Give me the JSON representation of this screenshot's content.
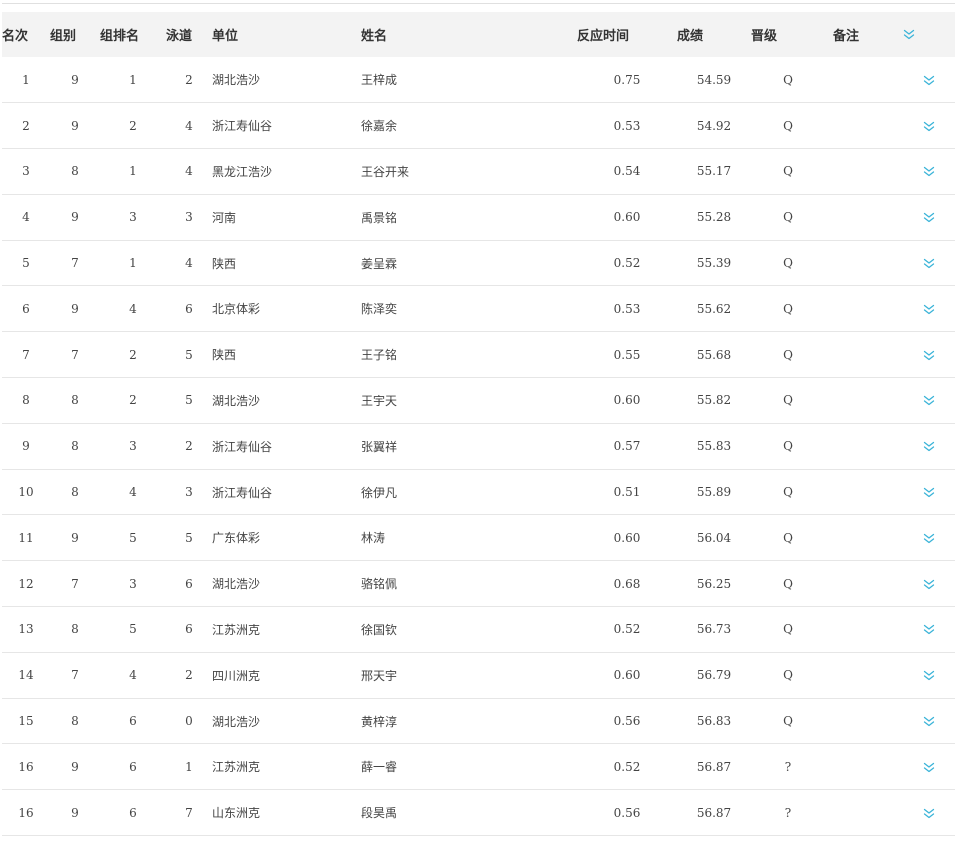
{
  "table": {
    "headers": {
      "rank": "名次",
      "group": "组别",
      "group_rank": "组排名",
      "lane": "泳道",
      "unit": "单位",
      "name": "姓名",
      "reaction": "反应时间",
      "result": "成绩",
      "qualify": "晋级",
      "remark": "备注"
    },
    "rows": [
      {
        "rank": "1",
        "group": "9",
        "group_rank": "1",
        "lane": "2",
        "unit": "湖北浩沙",
        "name": "王梓成",
        "reaction": "0.75",
        "result": "54.59",
        "qualify": "Q",
        "remark": ""
      },
      {
        "rank": "2",
        "group": "9",
        "group_rank": "2",
        "lane": "4",
        "unit": "浙江寿仙谷",
        "name": "徐嘉余",
        "reaction": "0.53",
        "result": "54.92",
        "qualify": "Q",
        "remark": ""
      },
      {
        "rank": "3",
        "group": "8",
        "group_rank": "1",
        "lane": "4",
        "unit": "黑龙江浩沙",
        "name": "王谷开来",
        "reaction": "0.54",
        "result": "55.17",
        "qualify": "Q",
        "remark": ""
      },
      {
        "rank": "4",
        "group": "9",
        "group_rank": "3",
        "lane": "3",
        "unit": "河南",
        "name": "禹景铭",
        "reaction": "0.60",
        "result": "55.28",
        "qualify": "Q",
        "remark": ""
      },
      {
        "rank": "5",
        "group": "7",
        "group_rank": "1",
        "lane": "4",
        "unit": "陕西",
        "name": "姜呈霖",
        "reaction": "0.52",
        "result": "55.39",
        "qualify": "Q",
        "remark": ""
      },
      {
        "rank": "6",
        "group": "9",
        "group_rank": "4",
        "lane": "6",
        "unit": "北京体彩",
        "name": "陈泽奕",
        "reaction": "0.53",
        "result": "55.62",
        "qualify": "Q",
        "remark": ""
      },
      {
        "rank": "7",
        "group": "7",
        "group_rank": "2",
        "lane": "5",
        "unit": "陕西",
        "name": "王子铭",
        "reaction": "0.55",
        "result": "55.68",
        "qualify": "Q",
        "remark": ""
      },
      {
        "rank": "8",
        "group": "8",
        "group_rank": "2",
        "lane": "5",
        "unit": "湖北浩沙",
        "name": "王宇天",
        "reaction": "0.60",
        "result": "55.82",
        "qualify": "Q",
        "remark": ""
      },
      {
        "rank": "9",
        "group": "8",
        "group_rank": "3",
        "lane": "2",
        "unit": "浙江寿仙谷",
        "name": "张翼祥",
        "reaction": "0.57",
        "result": "55.83",
        "qualify": "Q",
        "remark": ""
      },
      {
        "rank": "10",
        "group": "8",
        "group_rank": "4",
        "lane": "3",
        "unit": "浙江寿仙谷",
        "name": "徐伊凡",
        "reaction": "0.51",
        "result": "55.89",
        "qualify": "Q",
        "remark": ""
      },
      {
        "rank": "11",
        "group": "9",
        "group_rank": "5",
        "lane": "5",
        "unit": "广东体彩",
        "name": "林涛",
        "reaction": "0.60",
        "result": "56.04",
        "qualify": "Q",
        "remark": ""
      },
      {
        "rank": "12",
        "group": "7",
        "group_rank": "3",
        "lane": "6",
        "unit": "湖北浩沙",
        "name": "骆铭佩",
        "reaction": "0.68",
        "result": "56.25",
        "qualify": "Q",
        "remark": ""
      },
      {
        "rank": "13",
        "group": "8",
        "group_rank": "5",
        "lane": "6",
        "unit": "江苏洲克",
        "name": "徐国钦",
        "reaction": "0.52",
        "result": "56.73",
        "qualify": "Q",
        "remark": ""
      },
      {
        "rank": "14",
        "group": "7",
        "group_rank": "4",
        "lane": "2",
        "unit": "四川洲克",
        "name": "邢天宇",
        "reaction": "0.60",
        "result": "56.79",
        "qualify": "Q",
        "remark": ""
      },
      {
        "rank": "15",
        "group": "8",
        "group_rank": "6",
        "lane": "0",
        "unit": "湖北浩沙",
        "name": "黄梓淳",
        "reaction": "0.56",
        "result": "56.83",
        "qualify": "Q",
        "remark": ""
      },
      {
        "rank": "16",
        "group": "9",
        "group_rank": "6",
        "lane": "1",
        "unit": "江苏洲克",
        "name": "薛一睿",
        "reaction": "0.52",
        "result": "56.87",
        "qualify": "?",
        "remark": ""
      },
      {
        "rank": "16",
        "group": "9",
        "group_rank": "6",
        "lane": "7",
        "unit": "山东洲克",
        "name": "段昊禹",
        "reaction": "0.56",
        "result": "56.87",
        "qualify": "?",
        "remark": ""
      }
    ]
  },
  "icons": {
    "expand": "chevron-double-down-icon"
  },
  "colors": {
    "header_bg": "#f3f3f3",
    "accent": "#3bb4d8",
    "row_border": "#e6e6e6"
  }
}
